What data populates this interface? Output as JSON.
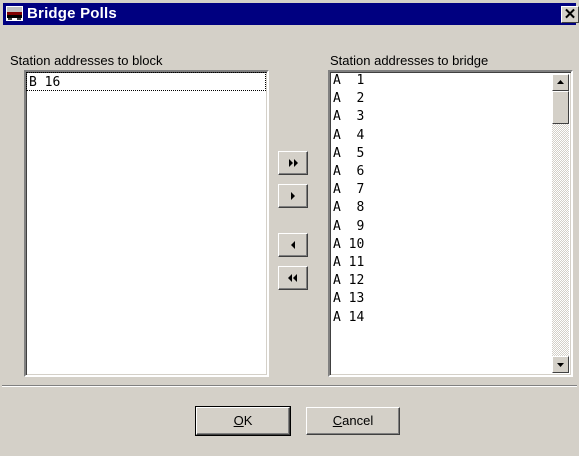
{
  "window": {
    "title": "Bridge Polls",
    "close_glyph": "✕",
    "icon": "app-icon"
  },
  "block_list": {
    "label": "Station addresses to block",
    "items": [
      "B 16"
    ]
  },
  "bridge_list": {
    "label": "Station addresses to bridge",
    "items": [
      "A  1",
      "A  2",
      "A  3",
      "A  4",
      "A  5",
      "A  6",
      "A  7",
      "A  8",
      "A  9",
      "A 10",
      "A 11",
      "A 12",
      "A 13",
      "A 14"
    ]
  },
  "transfer_buttons": {
    "move_all_right": "double-right-arrow-icon",
    "move_right": "right-arrow-icon",
    "move_left": "left-arrow-icon",
    "move_all_left": "double-left-arrow-icon"
  },
  "footer": {
    "ok_label": "OK",
    "ok_mnemonic": "O",
    "ok_rest": "K",
    "cancel_label": "Cancel",
    "cancel_mnemonic": "C",
    "cancel_rest": "ancel"
  },
  "colors": {
    "titlebar": "#000080",
    "face": "#d4d0c8"
  }
}
